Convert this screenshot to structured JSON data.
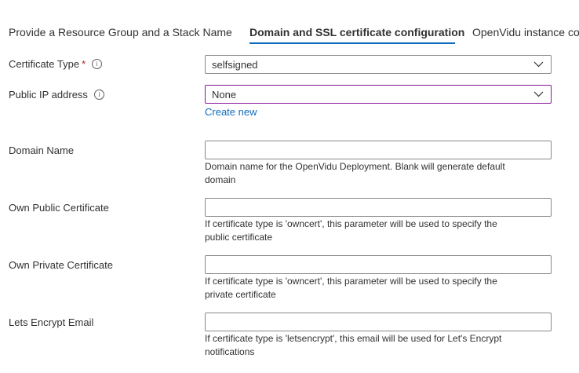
{
  "tabs": [
    {
      "label": "Provide a Resource Group and a Stack Name"
    },
    {
      "label": "Domain and SSL certificate configuration"
    },
    {
      "label": "OpenVidu instance co"
    }
  ],
  "form": {
    "certificate_type": {
      "label": "Certificate Type",
      "required_mark": "*",
      "info_icon": "i",
      "value": "selfsigned"
    },
    "public_ip": {
      "label": "Public IP address",
      "info_icon": "i",
      "value": "None",
      "create_link": "Create new"
    },
    "domain_name": {
      "label": "Domain Name",
      "value": "",
      "help_line1": "Domain name for the OpenVidu Deployment. Blank will generate default",
      "help_line2": "domain"
    },
    "own_public_cert": {
      "label": "Own Public Certificate",
      "value": "",
      "help_line1": "If certificate type is 'owncert', this parameter will be used to specify the",
      "help_line2": "public certificate"
    },
    "own_private_cert": {
      "label": "Own Private Certificate",
      "value": "",
      "help_line1": "If certificate type is 'owncert', this parameter will be used to specify the",
      "help_line2": "private certificate"
    },
    "letsencrypt_email": {
      "label": "Lets Encrypt Email",
      "value": "",
      "help_line1": "If certificate type is 'letsencrypt', this email will be used for Let's Encrypt",
      "help_line2": "notifications"
    }
  },
  "colors": {
    "accent": "#0f6cbd",
    "focus_border": "#881798",
    "required": "#a4262c"
  }
}
